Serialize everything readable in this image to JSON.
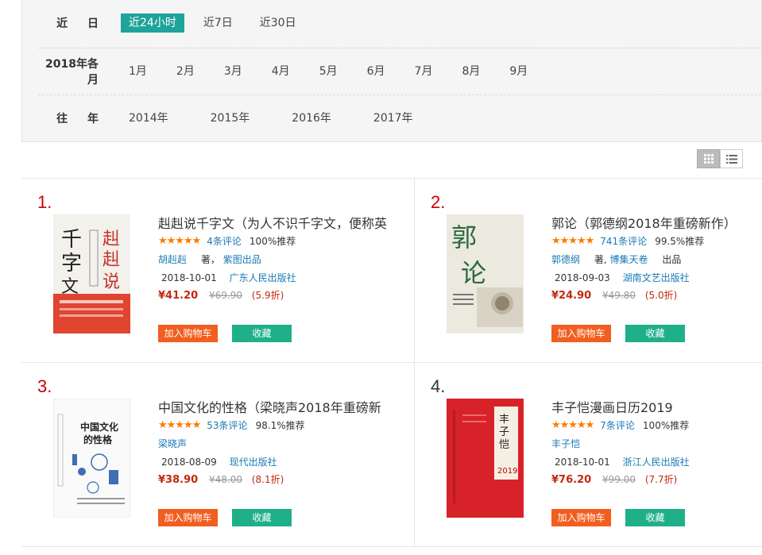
{
  "filters": {
    "recent": {
      "label": "近 日",
      "options": [
        "近24小时",
        "近7日",
        "近30日"
      ],
      "active": 0
    },
    "months": {
      "label": "2018年各月",
      "options": [
        "1月",
        "2月",
        "3月",
        "4月",
        "5月",
        "6月",
        "7月",
        "8月",
        "9月"
      ]
    },
    "years": {
      "label": "往 年",
      "options": [
        "2014年",
        "2015年",
        "2016年",
        "2017年"
      ]
    }
  },
  "view_toggle": {
    "grid_icon": "grid-icon",
    "list_icon": "list-icon",
    "active": "grid"
  },
  "books": [
    {
      "rank": "1.",
      "title": "赳赳说千字文（为人不识千字文，便称英",
      "rating_stars": 5,
      "stars_text": "★★★★★",
      "reviews": "4条评论",
      "recommend": "100%推荐",
      "author": "胡赳赳",
      "author_suffix": "著，",
      "producer": "紫图出品",
      "date": "2018-10-01",
      "publisher": "广东人民出版社",
      "price": "¥41.20",
      "original_price": "¥69.90",
      "discount": "(5.9折)",
      "cart_label": "加入购物车",
      "fav_label": "收藏",
      "cover_text": "千字文 赳赳说"
    },
    {
      "rank": "2.",
      "title": "郭论（郭德纲2018年重磅新作）",
      "rating_stars": 5,
      "stars_text": "★★★★★",
      "reviews": "741条评论",
      "recommend": "99.5%推荐",
      "author": "郭德纲",
      "author_suffix": "著,",
      "producer": "博集天卷",
      "producer_suffix": "出品",
      "date": "2018-09-03",
      "publisher": "湖南文艺出版社",
      "price": "¥24.90",
      "original_price": "¥49.80",
      "discount": "(5.0折)",
      "cart_label": "加入购物车",
      "fav_label": "收藏",
      "cover_text": "郭论"
    },
    {
      "rank": "3.",
      "title": "中国文化的性格（梁晓声2018年重磅新",
      "rating_stars": 5,
      "stars_text": "★★★★★",
      "reviews": "53条评论",
      "recommend": "98.1%推荐",
      "author": "梁晓声",
      "date": "2018-08-09",
      "publisher": "现代出版社",
      "price": "¥38.90",
      "original_price": "¥48.00",
      "discount": "(8.1折)",
      "cart_label": "加入购物车",
      "fav_label": "收藏",
      "cover_text": "中国文化的性格"
    },
    {
      "rank": "4.",
      "title": "丰子恺漫画日历2019",
      "rating_stars": 5,
      "stars_text": "★★★★★",
      "reviews": "7条评论",
      "recommend": "100%推荐",
      "author": "丰子恺",
      "date": "2018-10-01",
      "publisher": "浙江人民出版社",
      "price": "¥76.20",
      "original_price": "¥99.00",
      "discount": "(7.7折)",
      "cart_label": "加入购物车",
      "fav_label": "收藏",
      "cover_text": "丰子恺 2019"
    }
  ],
  "colors": {
    "active_filter": "#1fa39a",
    "cart_button": "#f25e1f",
    "fav_button": "#1fb08a",
    "price": "#c2290f",
    "link": "#1a7ab5",
    "rank_top3": "#cc0000",
    "stars": "#ff7a00"
  }
}
